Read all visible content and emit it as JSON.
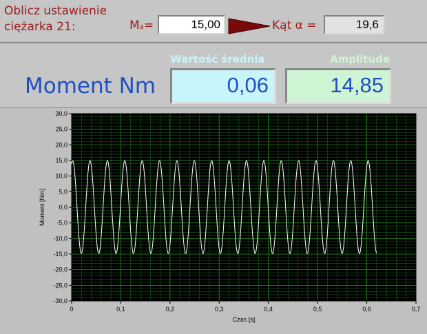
{
  "header": {
    "prompt_line1": "Oblicz ustawienie",
    "prompt_line2": "ciężarka 21:",
    "ma_label": "M",
    "ma_sub": "a",
    "ma_eq": "=",
    "ma_value": "15,00",
    "angle_label": "Kąt α =",
    "angle_value": "19,6"
  },
  "moment": {
    "title": "Moment Nm",
    "mean_label": "Wartość średnia",
    "mean_value": "0,06",
    "amplitude_label": "Amplitude",
    "amplitude_value": "14,85"
  },
  "chart_data": {
    "type": "line",
    "xlabel": "Czas [s]",
    "ylabel": "Moment [Nm]",
    "xlim": [
      0,
      0.7
    ],
    "ylim": [
      -30,
      30
    ],
    "x_ticks": [
      "0",
      "0,1",
      "0,2",
      "0,3",
      "0,4",
      "0,5",
      "0,6",
      "0,7"
    ],
    "y_ticks": [
      "30,0",
      "25,0",
      "20,0",
      "15,0",
      "10,0",
      "5,0",
      "0,0",
      "-5,0",
      "-10,0",
      "-15,0",
      "-20,0",
      "-25,0",
      "-30,0"
    ],
    "grid": true,
    "background": "#000000",
    "grid_color": "#1e7a1e",
    "series": [
      {
        "color": "#ffffff",
        "x_start": 0,
        "x_end": 0.62,
        "mean": 0.06,
        "amplitude": 14.85,
        "frequency_hz": 28.3
      }
    ]
  },
  "colors": {
    "prompt_red": "#9a1b1b",
    "title_blue": "#1f4fc4",
    "mean_label": "#c8f4fb",
    "amplitude_label": "#cdf5d4"
  }
}
